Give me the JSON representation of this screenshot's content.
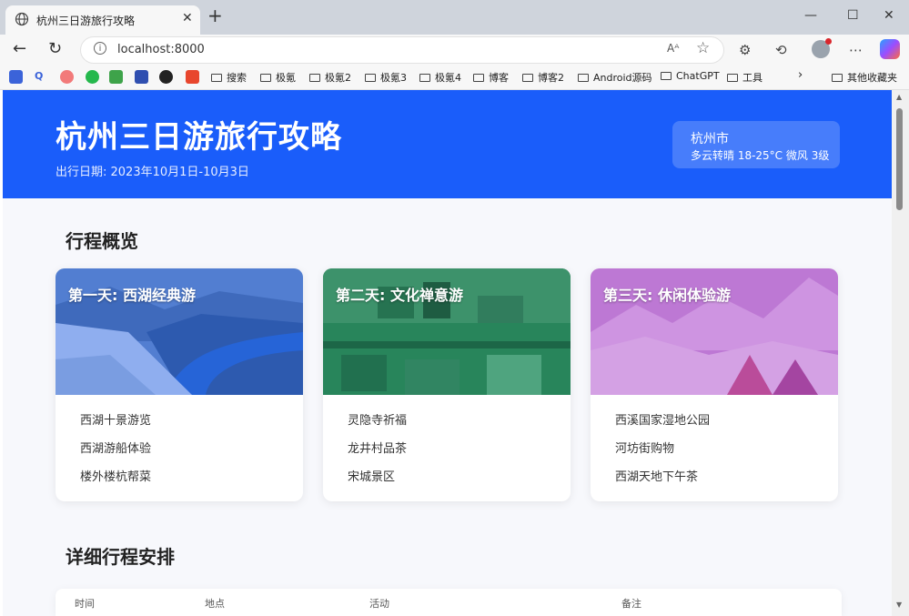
{
  "browser": {
    "tab_title": "杭州三日游旅行攻略",
    "url": "localhost:8000",
    "read_aloud_label": "Aᴬ",
    "bookmarks": [
      "搜索",
      "极氪",
      "极氪2",
      "极氪3",
      "极氪4",
      "博客",
      "博客2",
      "Android源码",
      "ChatGPT",
      "工具"
    ],
    "other_bookmarks": "其他收藏夹"
  },
  "header": {
    "title": "杭州三日游旅行攻略",
    "date": "出行日期: 2023年10月1日-10月3日",
    "weather_city": "杭州市",
    "weather_text": "多云转晴 18-25°C 微风 3级"
  },
  "overview": {
    "title": "行程概览",
    "cards": [
      {
        "title": "第一天: 西湖经典游",
        "items": [
          "西湖十景游览",
          "西湖游船体验",
          "楼外楼杭帮菜"
        ]
      },
      {
        "title": "第二天: 文化禅意游",
        "items": [
          "灵隐寺祈福",
          "龙井村品茶",
          "宋城景区"
        ]
      },
      {
        "title": "第三天: 休闲体验游",
        "items": [
          "西溪国家湿地公园",
          "河坊街购物",
          "西湖天地下午茶"
        ]
      }
    ]
  },
  "details": {
    "title": "详细行程安排",
    "columns": [
      "时间",
      "地点",
      "活动",
      "备注"
    ]
  },
  "colors": {
    "hero": "#1a5dfa",
    "card1_overlay": "#2f6bf0",
    "card2_overlay": "#1e9a68",
    "card3_overlay": "#b24fd0"
  }
}
